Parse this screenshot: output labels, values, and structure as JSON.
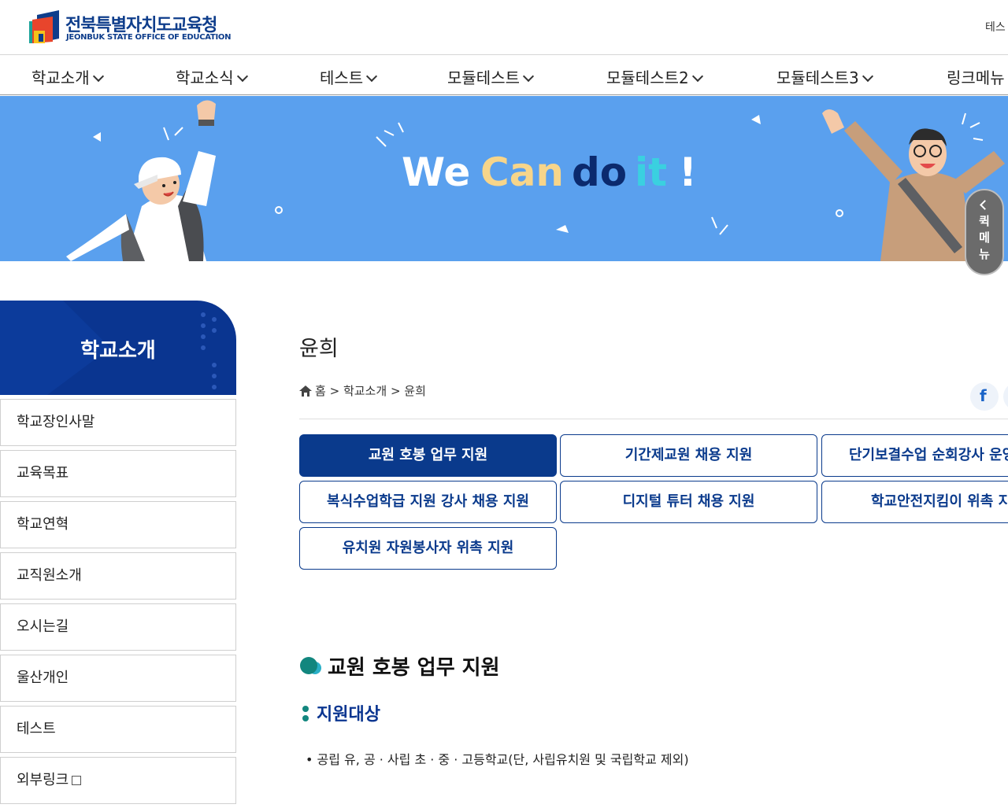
{
  "header": {
    "logo_ko": "전북특별자치도교육청",
    "logo_en": "JEONBUK STATE OFFICE OF EDUCATION",
    "util_text": "테스"
  },
  "gnb": [
    {
      "label": "학교소개"
    },
    {
      "label": "학교소식"
    },
    {
      "label": "테스트"
    },
    {
      "label": "모듈테스트"
    },
    {
      "label": "모듈테스트2"
    },
    {
      "label": "모듈테스트3"
    },
    {
      "label": "링크메뉴"
    }
  ],
  "banner": {
    "slogan": [
      "We",
      "Can",
      "do",
      "it",
      "!"
    ],
    "slogan_colors": [
      "#ffffff",
      "#f7d58a",
      "#0b2a6e",
      "#3ad0e0",
      "#ffffff"
    ],
    "bg_color": "#5aa0ee"
  },
  "quick_menu": {
    "label": "퀵메뉴"
  },
  "lnb": {
    "title": "학교소개",
    "items": [
      {
        "label": "학교장인사말"
      },
      {
        "label": "교육목표"
      },
      {
        "label": "학교연혁"
      },
      {
        "label": "교직원소개"
      },
      {
        "label": "오시는길"
      },
      {
        "label": "울산개인"
      },
      {
        "label": "테스트"
      },
      {
        "label": "외부링크"
      }
    ]
  },
  "content": {
    "page_title": "윤희",
    "breadcrumb": {
      "home": "홈",
      "sep": ">",
      "level1": "학교소개",
      "level2": "윤희"
    },
    "tabs": [
      {
        "label": "교원 호봉 업무 지원",
        "active": true
      },
      {
        "label": "기간제교원 채용 지원",
        "active": false
      },
      {
        "label": "단기보결수업 순회강사 운영",
        "active": false
      },
      {
        "label": "복식수업학급 지원 강사 채용 지원",
        "active": false
      },
      {
        "label": "디지털 튜터 채용 지원",
        "active": false
      },
      {
        "label": "학교안전지킴이 위촉 지원",
        "active": false
      },
      {
        "label": "유치원 자원봉사자 위촉 지원",
        "active": false
      }
    ],
    "section_title": "교원 호봉 업무 지원",
    "sub_title": "지원대상",
    "bullet": "• 공립 유, 공 · 사립 초 · 중 · 고등학교(단, 사립유치원 및 국립학교 제외)"
  },
  "colors": {
    "primary": "#0a3590",
    "accent_teal": "#1aa39a"
  }
}
